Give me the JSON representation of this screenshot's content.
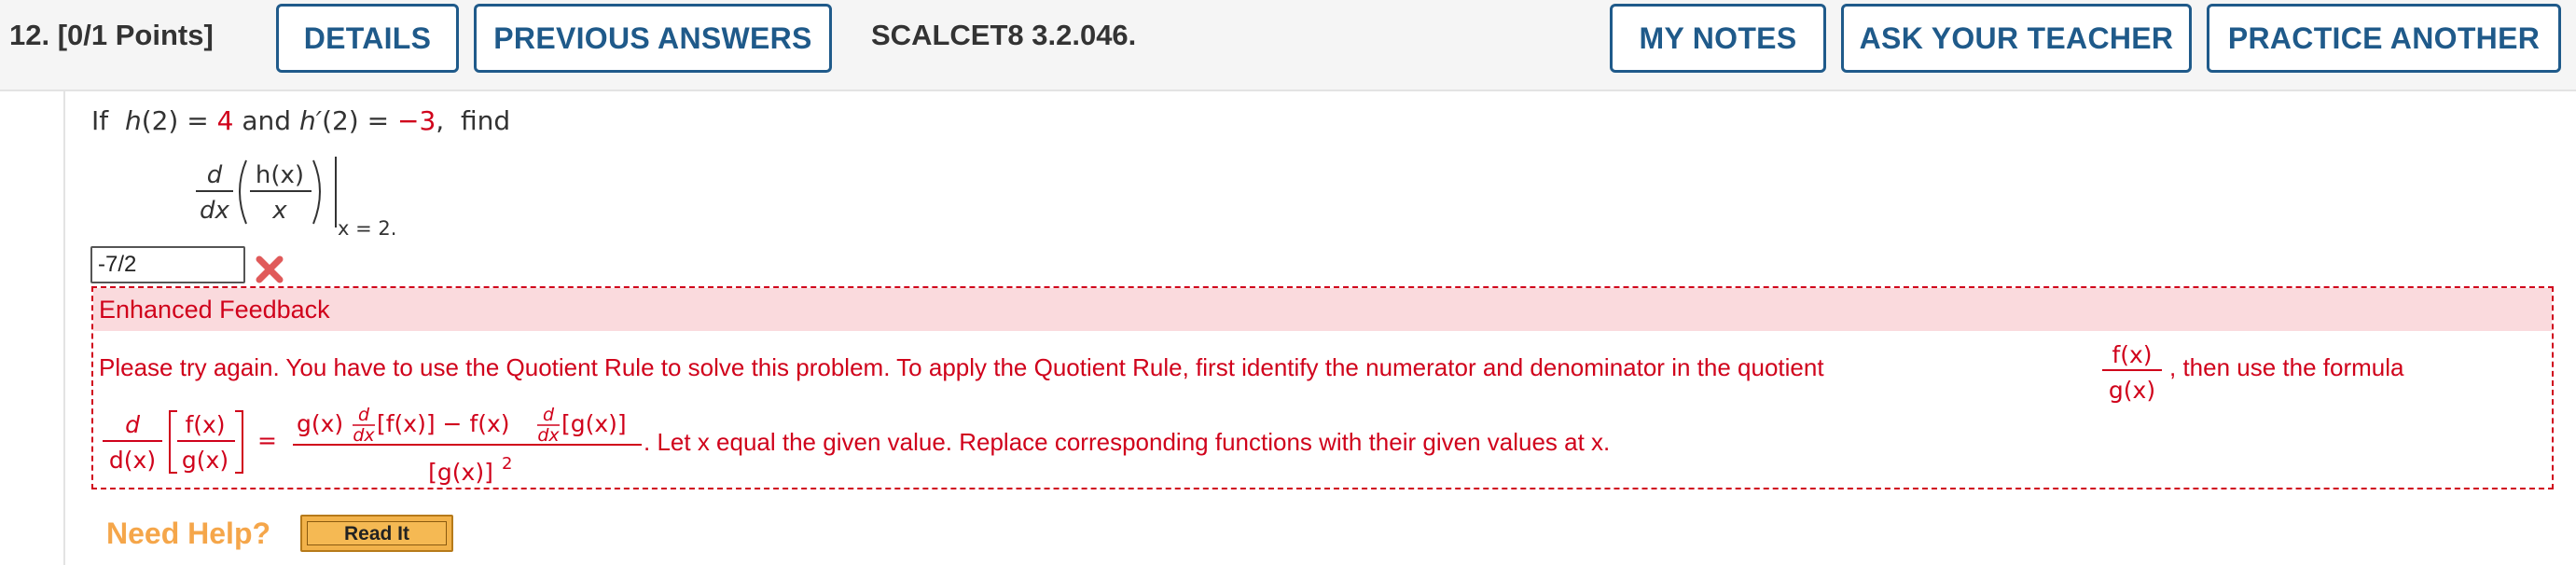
{
  "header": {
    "question_label": "12.  [0/1 Points]",
    "details_label": "DETAILS",
    "previous_answers_label": "PREVIOUS ANSWERS",
    "question_ref": "SCALCET8 3.2.046.",
    "my_notes_label": "MY NOTES",
    "ask_teacher_label": "ASK YOUR TEACHER",
    "practice_label": "PRACTICE ANOTHER"
  },
  "question": {
    "prefix": "If",
    "h_of": "h",
    "arg": "(2) =",
    "h_value": "4",
    "and_text": "and",
    "hprime_of": "h′",
    "hprime_value": "−3",
    "find_text": "find",
    "deriv_num": "d",
    "deriv_den": "dx",
    "inner_num": "h(x)",
    "inner_den": "x",
    "eval_at": "x = 2."
  },
  "answer": {
    "value": "-7/2",
    "status_icon": "x-mark-icon"
  },
  "feedback": {
    "title": "Enhanced Feedback",
    "line1_text": "Please try again. You have to use the Quotient Rule to solve this problem. To apply the Quotient Rule, first identify the numerator and denominator in the quotient",
    "quotient_num": "f(x)",
    "quotient_den": "g(x)",
    "line1_tail": ",  then use the formula",
    "formula_d_num": "d",
    "formula_d_den": "d(x)",
    "formula_f": "f(x)",
    "formula_g": "g(x)",
    "equals": "=",
    "rhs_num_a": "g(x)",
    "rhs_num_b": "[f(x)] − f(x)",
    "rhs_num_c": "[g(x)]",
    "small_d": "d",
    "small_dx": "dx",
    "rhs_den": "[g(x)]",
    "rhs_den_exp": "2",
    "line2_text": ".  Let x equal the given value. Replace corresponding functions with their given values at x."
  },
  "help": {
    "need_help_label": "Need Help?",
    "read_it_label": "Read It"
  },
  "colors": {
    "accent": "#1f5a8a",
    "error": "#d0021b",
    "feedback_bg": "#fadadd",
    "help_orange": "#f5a64a"
  }
}
